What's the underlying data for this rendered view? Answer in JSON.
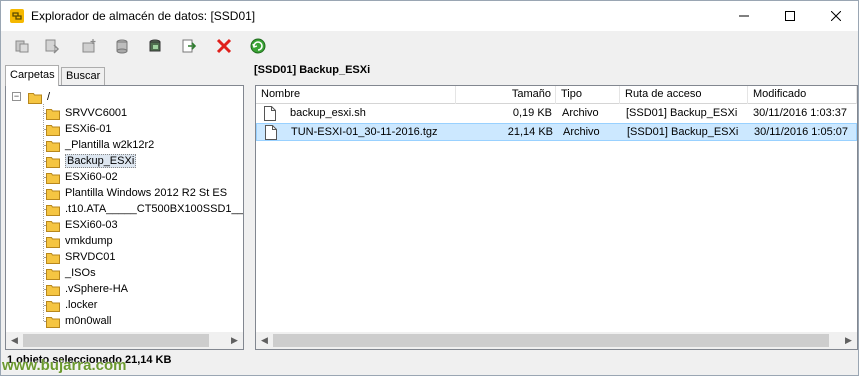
{
  "window": {
    "title": "Explorador de almacén de datos: [SSD01]"
  },
  "toolbar": {
    "buttons": [
      {
        "icon": "upload-icon"
      },
      {
        "icon": "download-icon"
      },
      {
        "icon": "new-folder-icon"
      },
      {
        "icon": "datastore-icon"
      },
      {
        "icon": "register-vm-icon"
      },
      {
        "icon": "move-icon"
      },
      {
        "icon": "delete-icon"
      },
      {
        "icon": "refresh-icon"
      }
    ]
  },
  "tabs": {
    "folders": "Carpetas",
    "search": "Buscar"
  },
  "tree": {
    "root": "/",
    "items": [
      "SRVVC6001",
      "ESXi6-01",
      "_Plantilla w2k12r2",
      "Backup_ESXi",
      "ESXi60-02",
      "Plantilla Windows 2012 R2 St ES",
      ".t10.ATA_____CT500BX100SSD1___",
      "ESXi60-03",
      "vmkdump",
      "SRVDC01",
      "_ISOs",
      ".vSphere-HA",
      ".locker",
      "m0n0wall"
    ],
    "selected": "Backup_ESXi"
  },
  "content": {
    "path_header": "[SSD01] Backup_ESXi",
    "columns": [
      "Nombre",
      "Tamaño",
      "Tipo",
      "Ruta de acceso",
      "Modificado"
    ],
    "files": [
      {
        "name": "backup_esxi.sh",
        "size": "0,19 KB",
        "type": "Archivo",
        "path": "[SSD01] Backup_ESXi",
        "modified": "30/11/2016 1:03:37"
      },
      {
        "name": "TUN-ESXI-01_30-11-2016.tgz",
        "size": "21,14 KB",
        "type": "Archivo",
        "path": "[SSD01] Backup_ESXi",
        "modified": "30/11/2016 1:05:07"
      }
    ]
  },
  "status": {
    "text": "1 objeto seleccionado 21,14 KB"
  },
  "watermark": "www.bujarra.com",
  "colors": {
    "selection": "#cce8ff",
    "folder": "#f5c542",
    "delete": "#e0201b",
    "refresh": "#3aa335",
    "watermark": "#6c9a2f"
  }
}
